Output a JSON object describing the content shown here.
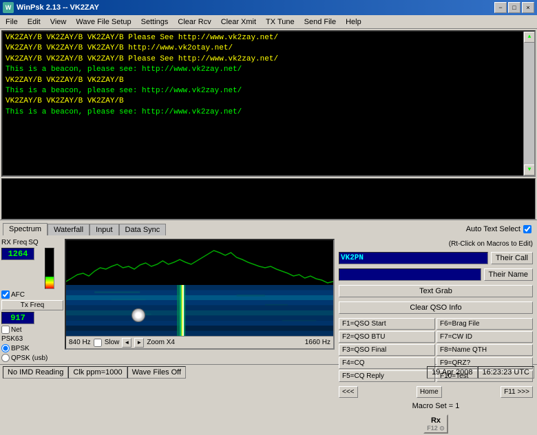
{
  "titlebar": {
    "title": "WinPsk 2.13 -- VK2ZAY",
    "icon": "W",
    "btn_min": "−",
    "btn_max": "□",
    "btn_close": "×"
  },
  "menubar": {
    "items": [
      "File",
      "Edit",
      "View",
      "Wave File Setup",
      "Settings",
      "Clear Rcv",
      "Clear Xmit",
      "TX Tune",
      "Send File",
      "Help"
    ]
  },
  "terminal": {
    "lines": [
      {
        "text": "VK2ZAY/B VK2ZAY/B VK2ZAY/B Please See http://www.vk2zay.net/",
        "class": "line-yellow"
      },
      {
        "text": "VK2ZAY/B VK2ZAY/B VK2ZAY/B http://www.vk2otay.net/",
        "class": "line-yellow"
      },
      {
        "text": "VK2ZAY/B VK2ZAY/B VK2ZAY/B Please See http://www.vk2zay.net/",
        "class": "line-yellow"
      },
      {
        "text": "This is a beacon, please see:  http://www.vk2zay.net/",
        "class": "line-green"
      },
      {
        "text": "VK2ZAY/B VK2ZAY/B VK2ZAY/B",
        "class": "line-yellow"
      },
      {
        "text": "This is a beacon, please see:  http://www.vk2zay.net/",
        "class": "line-green"
      },
      {
        "text": "VK2ZAY/B VK2ZAY/B VK2ZAY/B",
        "class": "line-yellow"
      },
      {
        "text": "This is a beacon, please see:  http://www.vk2zay.net/",
        "class": "line-green"
      }
    ]
  },
  "controls": {
    "rx_freq_label": "RX Freq",
    "sq_label": "SQ",
    "rx_freq_value": "1264",
    "afc_label": "AFC",
    "afc_checked": true,
    "tx_freq_label": "Tx Freq",
    "tx_freq_value": "917",
    "net_label": "Net",
    "psk63_label": "PSK63",
    "bpsk_label": "BPSK",
    "qpsk_label": "QPSK (usb)"
  },
  "spectrum_bar": {
    "freq_left": "840 Hz",
    "slow_label": "Slow",
    "zoom_label": "Zoom X4",
    "freq_right": "1660 Hz"
  },
  "tabs": {
    "content_tabs": [
      "Spectrum",
      "Waterfall",
      "Input",
      "Data Sync"
    ],
    "active": "Spectrum"
  },
  "auto_text": {
    "label": "Auto Text Select",
    "checked": true
  },
  "right_panel": {
    "rt_click_note": "(Rt-Click on Macros to Edit)",
    "call_input_value": "VK2PN",
    "their_call_btn": "Their Call",
    "their_name_btn": "Their Name",
    "text_grab_btn": "Text Grab",
    "clear_qso_btn": "Clear QSO Info",
    "macros": [
      {
        "id": "f1",
        "label": "F1=QSO Start"
      },
      {
        "id": "f6",
        "label": "F6=Brag File"
      },
      {
        "id": "f2",
        "label": "F2=QSO BTU"
      },
      {
        "id": "f7",
        "label": "F7=CW ID"
      },
      {
        "id": "f3",
        "label": "F3=QSO Final"
      },
      {
        "id": "f8",
        "label": "F8=Name QTH"
      },
      {
        "id": "f4",
        "label": "F4=CQ"
      },
      {
        "id": "f9",
        "label": "F9=QRZ?"
      },
      {
        "id": "f5",
        "label": "F5=CQ Reply"
      },
      {
        "id": "f10",
        "label": "F10=Test"
      }
    ],
    "nav_prev": "<<<",
    "nav_home": "Home",
    "nav_next": "F11 >>>",
    "macro_set_label": "Macro Set = 1",
    "rx_btn": "Rx",
    "tx_f12": "F12"
  },
  "status_bar": {
    "no_imd": "No IMD Reading",
    "clk_ppm": "Clk ppm=1000",
    "wave_files": "Wave Files Off",
    "date": "19 Apr 2008",
    "time": "16:23:23 UTC"
  }
}
